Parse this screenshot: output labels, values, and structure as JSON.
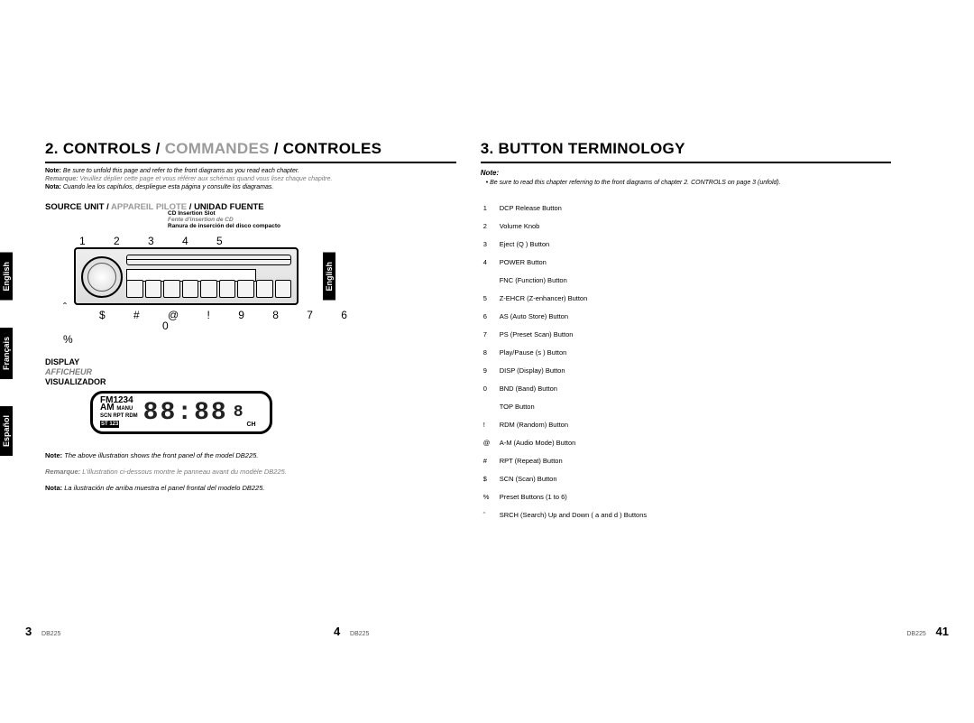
{
  "left": {
    "heading_prefix": "2. ",
    "heading_en": "CONTROLS",
    "heading_sep": " / ",
    "heading_fr": "COMMANDES",
    "heading_es": "CONTROLES",
    "note_en_label": "Note:",
    "note_en": " Be sure to unfold this page and refer to the front diagrams as you read each chapter.",
    "note_fr_label": "Remarque:",
    "note_fr": " Veuillez déplier cette page et vous référer aux schémas quand vous lisez chaque chapitre.",
    "note_es_label": "Nota:",
    "note_es": " Cuando lea los capítulos, despliegue esta página y consulte los diagramas.",
    "sub_en": "SOURCE UNIT",
    "sub_fr": "APPAREIL PILOTE",
    "sub_es": "UNIDAD FUENTE",
    "cd_lbl_en": "CD Insertion Slot",
    "cd_lbl_fr": "Fente d'insertion de CD",
    "cd_lbl_es": "Ranura de inserción del disco compacto",
    "callout_top": "1 2 3  4  5",
    "callout_left_1": "ˆ",
    "callout_left_2": "%",
    "callout_bottom": "$ # @ !  9 8 7 6",
    "callout_bottom_2": "0",
    "display_en": "DISPLAY",
    "display_fr": "AFFICHEUR",
    "display_es": "VISUALIZADOR",
    "lcd_top": "FM1234",
    "lcd_am": "AM",
    "lcd_manu": "MANU",
    "lcd_row2": "SCN RPT RDM",
    "lcd_row3": "ST 123",
    "lcd_seg": "88:88",
    "lcd_ch": "CH",
    "fig_en_label": "Note:",
    "fig_en": " The above illustration shows the front panel of the model DB225.",
    "fig_fr_label": "Remarque:",
    "fig_fr": " L'illustration ci-dessous montre le panneau avant du modèle DB225.",
    "fig_es_label": "Nota:",
    "fig_es": " La ilustración de arriba muestra el panel frontal del modelo DB225."
  },
  "tabs": {
    "en": "English",
    "fr": "Français",
    "es": "Español"
  },
  "right": {
    "heading": "3. BUTTON TERMINOLOGY",
    "note_head": "Note:",
    "note_body": "Be sure to read this chapter referring to the front diagrams of chapter 2. CONTROLS on page 3 (unfold).",
    "items": [
      {
        "n": "1",
        "t": "DCP Release Button"
      },
      {
        "n": "2",
        "t": "Volume Knob"
      },
      {
        "n": "3",
        "t": "Eject (Q ) Button"
      },
      {
        "n": "4",
        "t": "POWER Button"
      },
      {
        "n": "",
        "t": "FNC (Function) Button"
      },
      {
        "n": "5",
        "t": "Z-EHCR (Z-enhancer) Button"
      },
      {
        "n": "6",
        "t": "AS (Auto Store) Button"
      },
      {
        "n": "7",
        "t": "PS (Preset Scan) Button"
      },
      {
        "n": "8",
        "t": "Play/Pause (s      ) Button"
      },
      {
        "n": "9",
        "t": "DISP (Display) Button"
      },
      {
        "n": "0",
        "t": "BND (Band) Button"
      },
      {
        "n": "",
        "t": "TOP Button"
      },
      {
        "n": "!",
        "t": "RDM (Random) Button"
      },
      {
        "n": "@",
        "t": "A-M (Audio Mode) Button"
      },
      {
        "n": "#",
        "t": "RPT (Repeat) Button"
      },
      {
        "n": "$",
        "t": "SCN (Scan) Button"
      },
      {
        "n": "%",
        "t": "Preset Buttons (1 to 6)"
      },
      {
        "n": "ˆ",
        "t": "SRCH (Search) Up and Down ( a   and  d  ) Buttons"
      }
    ]
  },
  "footer": {
    "p3": "3",
    "p4": "4",
    "p41": "41",
    "model": "DB225"
  }
}
